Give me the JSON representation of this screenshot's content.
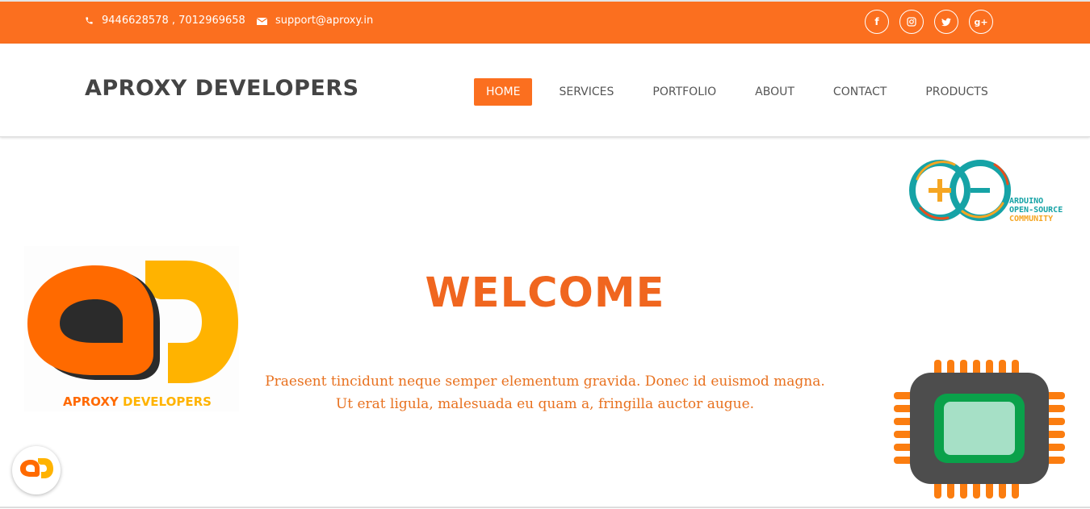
{
  "topbar": {
    "phone": "9446628578 , 7012969658",
    "email": "support@aproxy.in",
    "socials": [
      {
        "icon": "facebook-icon",
        "glyph": "f"
      },
      {
        "icon": "instagram-icon",
        "glyph": ""
      },
      {
        "icon": "twitter-icon",
        "glyph": ""
      },
      {
        "icon": "google-plus-icon",
        "glyph": "g+"
      }
    ]
  },
  "navbar": {
    "brand": "APROXY DEVELOPERS",
    "menu": [
      {
        "label": "HOME",
        "active": true
      },
      {
        "label": "SERVICES"
      },
      {
        "label": "PORTFOLIO"
      },
      {
        "label": "ABOUT"
      },
      {
        "label": "CONTACT"
      },
      {
        "label": "PRODUCTS"
      }
    ]
  },
  "hero": {
    "title": "WELCOME",
    "lead_line1": "Praesent tincidunt neque semper elementum gravida. Donec id euismod magna.",
    "lead_line2": "Ut erat ligula, malesuada eu quam a, fringilla auctor augue.",
    "logo_caption_part1": "APROXY",
    "logo_caption_part2": "DEVELOPERS",
    "arduino_line1": "ARDUINO",
    "arduino_line2": "OPEN-SOURCE",
    "arduino_line3": "COMMUNITY"
  },
  "colors": {
    "accent": "#fb6f1f",
    "heading": "#f0661f",
    "brand_text": "#444444",
    "logo_yellow": "#ffb300",
    "arduino_teal": "#16a3a6",
    "chip_green": "#0aa14a"
  }
}
